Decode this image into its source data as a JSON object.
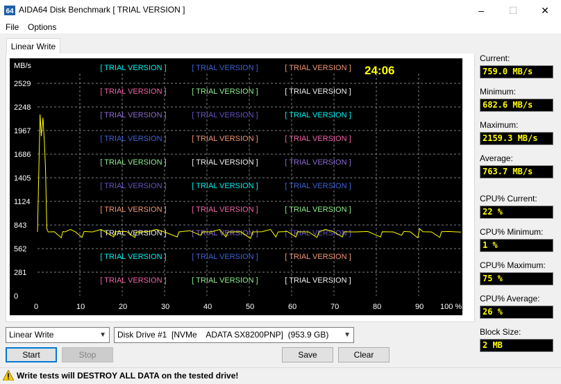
{
  "window": {
    "title": "AIDA64 Disk Benchmark  [ TRIAL VERSION ]",
    "minimize": "–",
    "maximize": "☐",
    "close": "✕"
  },
  "menu": {
    "file": "File",
    "options": "Options"
  },
  "tab": {
    "label": "Linear Write"
  },
  "timer": "24:06",
  "watermark": "[ TRIAL VERSION ]",
  "colors": {
    "chart_bg": "#000000",
    "grid": "#7f7f7f",
    "line": "#ffff00",
    "axis_text": "#ffffff",
    "value_text": "#ffff00",
    "watermark_colors": [
      "#00ffff",
      "#4169e1",
      "#ffa07a",
      "#ff69b4",
      "#98fb98",
      "#ffffff",
      "#9370db",
      "#6a5acd"
    ]
  },
  "chart_data": {
    "type": "line",
    "ylabel": "MB/s",
    "y_ticks": [
      "2529",
      "2248",
      "1967",
      "1686",
      "1405",
      "1124",
      "843",
      "562",
      "281",
      "0"
    ],
    "x_ticks": [
      "0",
      "10",
      "20",
      "30",
      "40",
      "50",
      "60",
      "70",
      "80",
      "90",
      "100 %"
    ],
    "xlim": [
      0,
      100
    ],
    "ylim": [
      0,
      2810
    ],
    "grid": true,
    "series": [
      {
        "values": [
          [
            0,
            760
          ],
          [
            0.6,
            2159
          ],
          [
            0.9,
            1900
          ],
          [
            1.3,
            2120
          ],
          [
            1.6,
            1850
          ],
          [
            1.9,
            1500
          ],
          [
            2.2,
            800
          ],
          [
            2.5,
            760
          ],
          [
            4,
            763
          ],
          [
            5.6,
            690
          ],
          [
            6,
            765
          ],
          [
            6.5,
            760
          ],
          [
            7.8,
            790
          ],
          [
            9,
            760
          ],
          [
            10.5,
            695
          ],
          [
            11,
            765
          ],
          [
            13,
            760
          ],
          [
            15,
            790
          ],
          [
            16,
            761
          ],
          [
            18,
            700
          ],
          [
            18.4,
            762
          ],
          [
            21,
            765
          ],
          [
            23,
            695
          ],
          [
            23.4,
            760
          ],
          [
            26,
            762
          ],
          [
            28,
            790
          ],
          [
            30,
            760
          ],
          [
            33,
            700
          ],
          [
            33.4,
            760
          ],
          [
            36,
            775
          ],
          [
            38.5,
            720
          ],
          [
            39,
            762
          ],
          [
            41,
            760
          ],
          [
            43,
            790
          ],
          [
            44.5,
            700
          ],
          [
            45,
            760
          ],
          [
            48,
            762
          ],
          [
            50.3,
            683
          ],
          [
            50.8,
            760
          ],
          [
            53,
            763
          ],
          [
            55,
            790
          ],
          [
            56.3,
            700
          ],
          [
            56.8,
            760
          ],
          [
            59,
            765
          ],
          [
            61,
            700
          ],
          [
            61.4,
            762
          ],
          [
            64,
            760
          ],
          [
            66,
            695
          ],
          [
            66.5,
            762
          ],
          [
            68,
            790
          ],
          [
            70,
            760
          ],
          [
            72,
            700
          ],
          [
            72.4,
            763
          ],
          [
            75,
            760
          ],
          [
            78,
            765
          ],
          [
            81,
            700
          ],
          [
            81.4,
            762
          ],
          [
            84,
            760
          ],
          [
            86,
            720
          ],
          [
            86.5,
            765
          ],
          [
            88,
            761
          ],
          [
            89.8,
            690
          ],
          [
            90.2,
            800
          ],
          [
            91,
            762
          ],
          [
            93,
            760
          ],
          [
            95,
            695
          ],
          [
            95.4,
            763
          ],
          [
            97,
            765
          ],
          [
            100,
            759
          ]
        ]
      }
    ]
  },
  "stats": {
    "current": {
      "label": "Current:",
      "value": "759.0 MB/s"
    },
    "minimum": {
      "label": "Minimum:",
      "value": "682.6 MB/s"
    },
    "maximum": {
      "label": "Maximum:",
      "value": "2159.3 MB/s"
    },
    "average": {
      "label": "Average:",
      "value": "763.7 MB/s"
    },
    "cpu_current": {
      "label": "CPU% Current:",
      "value": "22 %"
    },
    "cpu_minimum": {
      "label": "CPU% Minimum:",
      "value": "1 %"
    },
    "cpu_maximum": {
      "label": "CPU% Maximum:",
      "value": "75 %"
    },
    "cpu_average": {
      "label": "CPU% Average:",
      "value": "26 %"
    },
    "block_size": {
      "label": "Block Size:",
      "value": "2 MB"
    }
  },
  "controls": {
    "test_select": "Linear Write",
    "drive_select": "Disk Drive #1  [NVMe    ADATA SX8200PNP]  (953.9 GB)",
    "start": "Start",
    "stop": "Stop",
    "save": "Save",
    "clear": "Clear"
  },
  "status": {
    "warning": "Write tests will DESTROY ALL DATA on the tested drive!"
  }
}
